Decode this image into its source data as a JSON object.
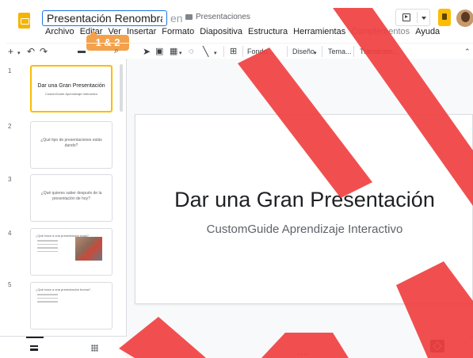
{
  "header": {
    "title_value": "Presentación Renombrada",
    "in_label": "en",
    "folder_name": "Presentaciones"
  },
  "menu": [
    "Archivo",
    "Editar",
    "Ver",
    "Insertar",
    "Formato",
    "Diapositiva",
    "Estructura",
    "Herramientas",
    "Complementos",
    "Ayuda"
  ],
  "callout": {
    "label": "1 & 2"
  },
  "toolbar": {
    "background_label": "Fondo...",
    "layout_label": "Diseño",
    "theme_label": "Tema...",
    "transition_label": "Transición..."
  },
  "filmstrip": {
    "slides": [
      {
        "number": "1",
        "title": "Dar una Gran Presentación",
        "subtitle": "CustomGuide Aprendizaje Interactivo"
      },
      {
        "number": "2",
        "text": "¿Qué tipo de presentaciones estás dando?"
      },
      {
        "number": "3",
        "text": "¿Qué quieres saber después de la presentación de hoy?"
      },
      {
        "number": "4",
        "text": "¿Qué hace a una presentación mala?"
      },
      {
        "number": "5",
        "text": "¿Qué hace a una presentación buena?"
      }
    ]
  },
  "slide": {
    "title": "Dar una Gran Presentación",
    "subtitle": "CustomGuide Aprendizaje Interactivo"
  },
  "colors": {
    "accent_blue": "#1a73e8",
    "slides_yellow": "#f4b400",
    "callout_orange": "#f4a14b",
    "selected_border": "#fbbc04"
  }
}
